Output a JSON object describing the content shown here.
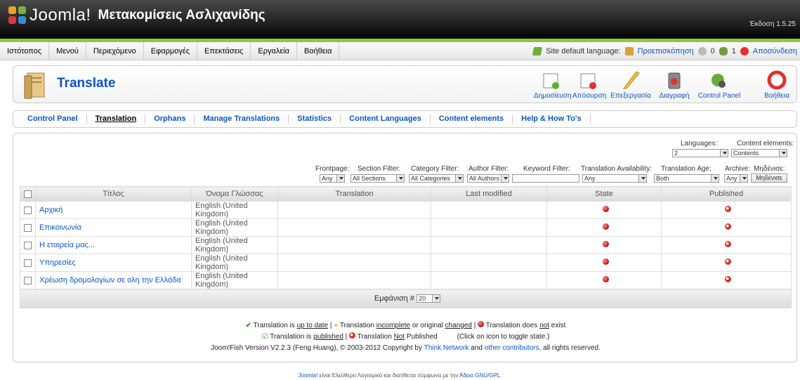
{
  "header": {
    "logo_text": "Joomla!",
    "site_name": "Μετακομίσεις Ασλιχανίδης",
    "version": "Έκδοση 1.5.25"
  },
  "menu": {
    "items": [
      "Ιστότοπος",
      "Μενού",
      "Περιεχόμενο",
      "Εφαρμογές",
      "Επεκτάσεις",
      "Εργαλεία",
      "Βοήθεια"
    ],
    "site_default_language": "Site default language:",
    "preview": "Προεπισκόπηση",
    "msg_count": "0",
    "users_count": "1",
    "logout": "Αποσύνδεση"
  },
  "toolbar": {
    "title": "Translate",
    "buttons": [
      "Δημοσίευση",
      "Απόσυρση",
      "Επεξεργασία",
      "Διαγραφή",
      "Control Panel",
      "Βοήθεια"
    ]
  },
  "submenu": {
    "items": [
      "Control Panel",
      "Translation",
      "Orphans",
      "Manage Translations",
      "Statistics",
      "Content Languages",
      "Content elements",
      "Help & How To's"
    ],
    "active": "Translation"
  },
  "filters": {
    "languages_label": "Languages:",
    "languages_value": "2",
    "content_elements_label": "Content elements:",
    "content_elements_value": "Contents",
    "frontpage_label": "Frontpage:",
    "frontpage_value": "Any",
    "section_label": "Section Filter:",
    "section_value": "All Sections",
    "category_label": "Category Filter:",
    "category_value": "All Categories",
    "author_label": "Author Filter:",
    "author_value": "All Authors",
    "keyword_label": "Keyword Filter:",
    "availability_label": "Translation Availability:",
    "availability_value": "Any",
    "age_label": "Translation Age:",
    "age_value": "Both",
    "archive_label": "Archive:",
    "archive_value": "Any",
    "reset_label": "Μηδένισε:",
    "reset_button": "Μηδένισε"
  },
  "table": {
    "headers": [
      "Τίτλος",
      "Όνομα Γλώσσας",
      "Translation",
      "Last modified",
      "State",
      "Published"
    ],
    "rows": [
      {
        "title": "Αρχική",
        "language": "English (United Kingdom)",
        "translation": "",
        "last_modified": ""
      },
      {
        "title": "Επικοινωνία",
        "language": "English (United Kingdom)",
        "translation": "",
        "last_modified": ""
      },
      {
        "title": "Η εταιρεία μας...",
        "language": "English (United Kingdom)",
        "translation": "",
        "last_modified": ""
      },
      {
        "title": "Υπηρεσίες",
        "language": "English (United Kingdom)",
        "translation": "",
        "last_modified": ""
      },
      {
        "title": "Χρέωση δρομολογίων σε ολη την Ελλάδα",
        "language": "English (United Kingdom)",
        "translation": "",
        "last_modified": ""
      }
    ],
    "display_label": "Εμφάνιση #",
    "display_value": "20"
  },
  "legend": {
    "l1a": "Translation is",
    "l1a_u": "up to date",
    "l1b": "Translation",
    "l1b_u": "incomplete",
    "l1b_m": "or original",
    "l1b_u2": "changed",
    "l1c": "Translation does",
    "l1c_u": "not",
    "l1c_e": "exist",
    "l2a": "Translation is",
    "l2a_u": "published",
    "l2b": "Translation",
    "l2b_u": "Not",
    "l2b_e": "Published",
    "l2c": "(Click on icon to toggle state.)",
    "l3a": "Joom!Fish Version V2.2.3 (Feng Huang), © 2003-2012 Copyright by",
    "l3b": "Think Network",
    "l3c": "and",
    "l3d": "other contributors",
    "l3e": ", all rights reserved."
  },
  "footer": {
    "a": "Joomla!",
    "b": "είναι Ελεύθερο Λογισμικό και διατίθεται σύμφωνα με την",
    "c": "Άδεια GNU/GPL",
    "d": "."
  }
}
